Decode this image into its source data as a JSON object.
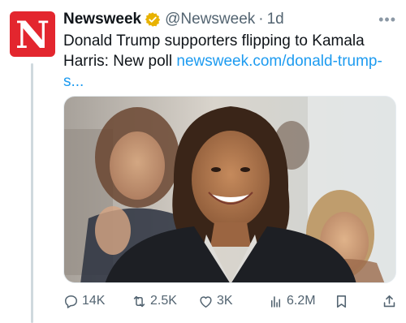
{
  "account": {
    "logo_letter": "N",
    "name": "Newsweek",
    "handle": "@Newsweek",
    "separator": "·",
    "time": "1d",
    "more_icon": "more-horizontal-icon",
    "brand_color": "#e3262e"
  },
  "post": {
    "text": "Donald Trump supporters flipping to Kamala Harris: New poll ",
    "link": "newsweek.com/donald-trump-s...",
    "media": "photo"
  },
  "actions": {
    "replies": "14K",
    "reposts": "2.5K",
    "likes": "3K",
    "views": "6.2M",
    "bookmark_icon": "bookmark-icon",
    "share_icon": "share-icon"
  },
  "colors": {
    "text": "#0f1419",
    "secondary": "#536471",
    "link": "#1d9bf0",
    "verified": "#e8b200"
  }
}
